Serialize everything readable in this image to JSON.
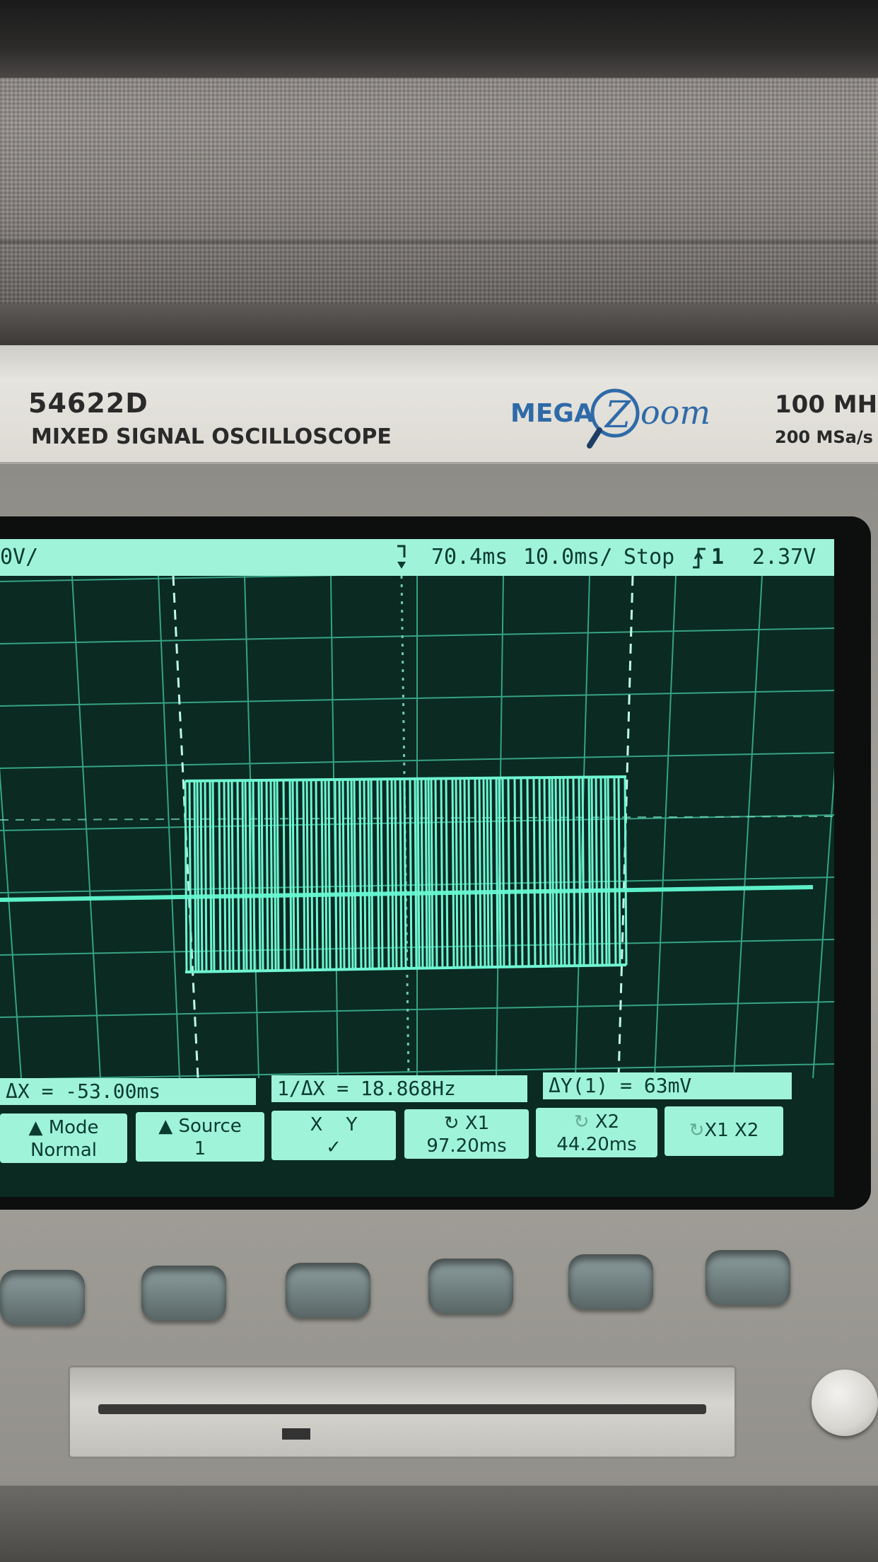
{
  "instrument": {
    "model": "54622D",
    "description": "MIXED SIGNAL OSCILLOSCOPE",
    "logo": {
      "mega": "MEGA",
      "zoom_letter": "Z",
      "zoom_rest": "oom"
    },
    "bandwidth": "100 MH",
    "sample_rate": "200 MSa/s"
  },
  "status_bar": {
    "channel_scale": "0V/",
    "time_delay": "70.4ms",
    "time_per_div": "10.0ms/",
    "run_state": "Stop",
    "trigger_source": "1",
    "trigger_level": "2.37V",
    "trigger_icon": "rising-edge-trigger-icon"
  },
  "measurements": {
    "delta_x": "ΔX = -53.00ms",
    "inverse_delta_x": "1/ΔX = 18.868Hz",
    "delta_y": "ΔY(1) = 63mV"
  },
  "softkeys": {
    "mode_title": "Mode",
    "mode_value": "Normal",
    "source_title": "Source",
    "source_value": "1",
    "xy_x": "X",
    "xy_y": "Y",
    "xy_check": "✓",
    "x1_title": "X1",
    "x1_value": "97.20ms",
    "x2_title": "X2",
    "x2_value": "44.20ms",
    "x1x2": "X1 X2"
  },
  "colors": {
    "phosphor": "#9ff3d9",
    "trace": "#5cf0c8",
    "screen_bg": "#0a2a22",
    "logo_blue": "#2f6aa8"
  }
}
